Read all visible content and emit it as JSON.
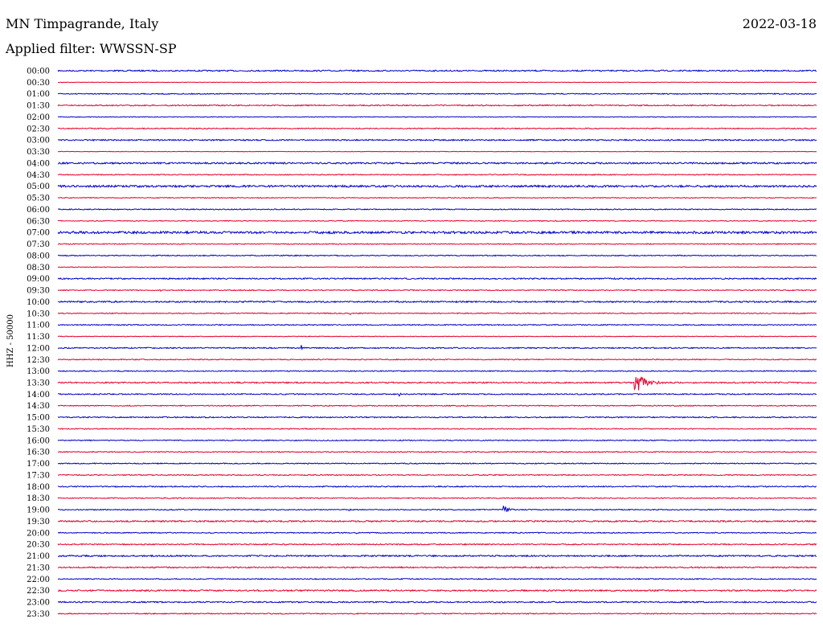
{
  "header": {
    "title": "MN Timpagrande, Italy",
    "date": "2022-03-18",
    "filter": "Applied filter: WWSSN-SP"
  },
  "colors": {
    "even_trace": "#0000c8",
    "odd_trace": "#e6002d"
  },
  "chart_data": {
    "type": "line",
    "title": "MN Timpagrande, Italy",
    "ylabel": "HHZ - 50000",
    "xlabel": "",
    "grid": false,
    "legend": "none",
    "row_labels": [
      "00:00",
      "00:30",
      "01:00",
      "01:30",
      "02:00",
      "02:30",
      "03:00",
      "03:30",
      "04:00",
      "04:30",
      "05:00",
      "05:30",
      "06:00",
      "06:30",
      "07:00",
      "07:30",
      "08:00",
      "08:30",
      "09:00",
      "09:30",
      "10:00",
      "10:30",
      "11:00",
      "11:30",
      "12:00",
      "12:30",
      "13:00",
      "13:30",
      "14:00",
      "14:30",
      "15:00",
      "15:30",
      "16:00",
      "16:30",
      "17:00",
      "17:30",
      "18:00",
      "18:30",
      "19:00",
      "19:30",
      "20:00",
      "20:30",
      "21:00",
      "21:30",
      "22:00",
      "22:30",
      "23:00",
      "23:30"
    ],
    "noise_level": [
      0.8,
      0.3,
      0.6,
      0.7,
      0.4,
      0.6,
      0.8,
      0.3,
      1.0,
      0.6,
      1.2,
      0.5,
      0.6,
      0.5,
      1.4,
      0.6,
      0.6,
      0.4,
      0.8,
      0.6,
      0.9,
      0.6,
      0.6,
      0.4,
      0.7,
      0.6,
      0.6,
      0.8,
      0.7,
      0.6,
      0.7,
      0.6,
      0.6,
      0.6,
      0.6,
      0.6,
      0.7,
      0.6,
      0.6,
      0.9,
      0.6,
      0.7,
      0.9,
      0.8,
      0.6,
      0.9,
      0.8,
      0.6
    ],
    "events": [
      {
        "row": "09:30",
        "minute": 4.0,
        "amplitude": 2.5,
        "duration_min": 0.4
      },
      {
        "row": "10:30",
        "minute": 11.5,
        "amplitude": 2.5,
        "duration_min": 0.4
      },
      {
        "row": "11:00",
        "minute": 11.9,
        "amplitude": 2.5,
        "duration_min": 0.3
      },
      {
        "row": "12:00",
        "minute": 9.6,
        "amplitude": 6,
        "duration_min": 0.3
      },
      {
        "row": "13:30",
        "minute": 22.8,
        "amplitude": 16,
        "duration_min": 1.5
      },
      {
        "row": "14:00",
        "minute": 13.5,
        "amplitude": 2.5,
        "duration_min": 0.3
      },
      {
        "row": "19:00",
        "minute": 11.5,
        "amplitude": 3,
        "duration_min": 0.3
      },
      {
        "row": "19:00",
        "minute": 17.6,
        "amplitude": 7,
        "duration_min": 0.8
      },
      {
        "row": "20:00",
        "minute": 11.8,
        "amplitude": 3,
        "duration_min": 0.3
      }
    ],
    "x_minutes_per_row": 30
  }
}
